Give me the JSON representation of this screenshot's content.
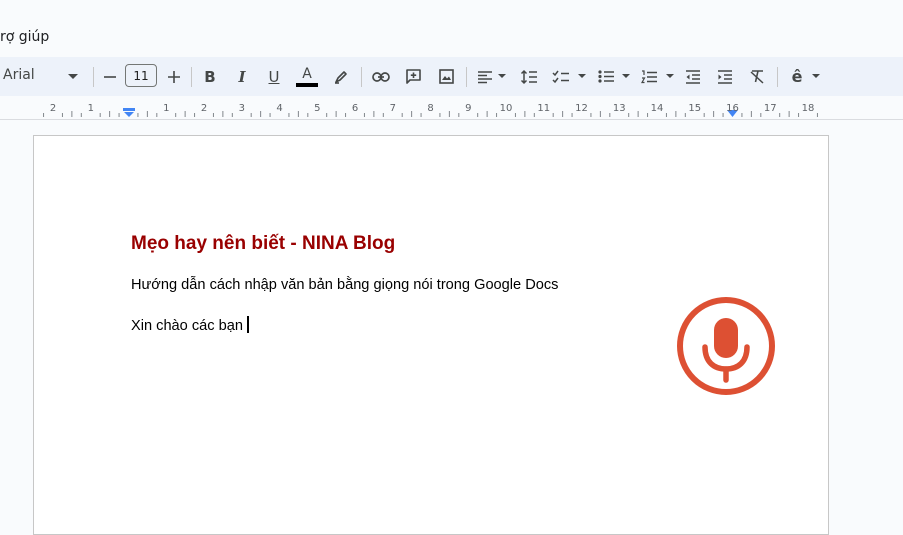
{
  "menubar": {
    "help_label": "rợ giúp"
  },
  "toolbar": {
    "font_name": "Arial",
    "font_size": "11",
    "bold_glyph": "B",
    "italic_glyph": "I",
    "underline_glyph": "U",
    "text_color_glyph": "A",
    "input_tools_glyph": "ê",
    "text_color": "#000000"
  },
  "ruler": {
    "labels": [
      "2",
      "1",
      "1",
      "2",
      "3",
      "4",
      "5",
      "6",
      "7",
      "8",
      "9",
      "10",
      "11",
      "12",
      "13",
      "14",
      "15",
      "16",
      "17",
      "18"
    ]
  },
  "document": {
    "title": "Mẹo hay nên biết - NINA Blog",
    "subtitle": "Hướng dẫn cách nhập văn bản bằng giọng nói trong Google Docs",
    "typed_text": "Xin chào các bạn",
    "title_color": "#990000"
  },
  "voice_typing": {
    "icon": "microphone-icon",
    "state": "listening",
    "color": "#dd5033"
  }
}
